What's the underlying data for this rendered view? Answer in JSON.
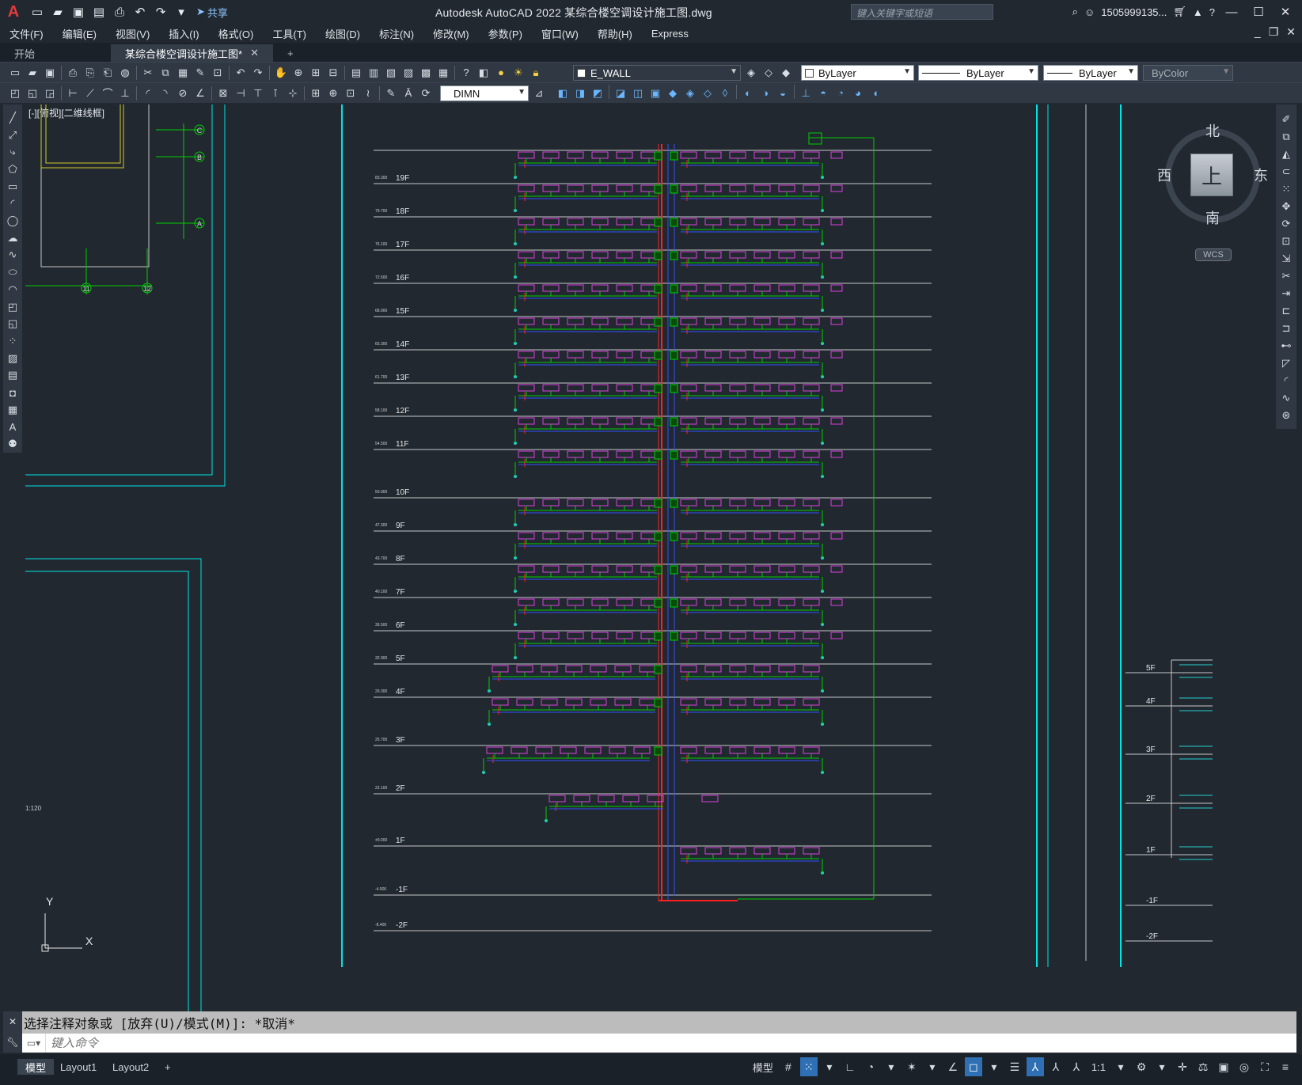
{
  "app": {
    "title": "Autodesk AutoCAD 2022    某综合楼空调设计施工图.dwg",
    "search_placeholder": "键入关键字或短语",
    "user": "1505999135...",
    "share_label": "共享"
  },
  "menu": [
    "文件(F)",
    "编辑(E)",
    "视图(V)",
    "插入(I)",
    "格式(O)",
    "工具(T)",
    "绘图(D)",
    "标注(N)",
    "修改(M)",
    "参数(P)",
    "窗口(W)",
    "帮助(H)",
    "Express"
  ],
  "tabs": [
    {
      "label": "开始"
    },
    {
      "label": "某综合楼空调设计施工图*"
    }
  ],
  "toolbar": {
    "layer": "E_WALL",
    "color": "ByLayer",
    "linetype": "ByLayer",
    "lineweight": "ByLayer",
    "plotstyle": "ByColor",
    "dimstyle": "DIMN"
  },
  "viewport": {
    "label": "[-][俯视][二维线框]",
    "viewcube": {
      "top": "上",
      "north": "北",
      "south": "南",
      "east": "东",
      "west": "西",
      "wcs": "WCS"
    }
  },
  "drawing": {
    "floors": [
      {
        "label": "19F",
        "elev": "83.300"
      },
      {
        "label": "18F",
        "elev": "79.700"
      },
      {
        "label": "17F",
        "elev": "76.100"
      },
      {
        "label": "16F",
        "elev": "72.500"
      },
      {
        "label": "15F",
        "elev": "68.900"
      },
      {
        "label": "14F",
        "elev": "65.300"
      },
      {
        "label": "13F",
        "elev": "61.700"
      },
      {
        "label": "12F",
        "elev": "58.100"
      },
      {
        "label": "11F",
        "elev": "54.500"
      },
      {
        "label": "10F",
        "elev": "50.900"
      },
      {
        "label": "9F",
        "elev": "47.300"
      },
      {
        "label": "8F",
        "elev": "43.700"
      },
      {
        "label": "7F",
        "elev": "40.100"
      },
      {
        "label": "6F",
        "elev": "36.500"
      },
      {
        "label": "5F",
        "elev": "32.900"
      },
      {
        "label": "4F",
        "elev": "29.300"
      },
      {
        "label": "3F",
        "elev": "25.700"
      },
      {
        "label": "2F",
        "elev": "22.100"
      },
      {
        "label": "1F",
        "elev": "±0.000"
      },
      {
        "label": "-1F",
        "elev": "-4.500"
      },
      {
        "label": "-2F",
        "elev": "-8.400"
      }
    ],
    "right_floors": [
      "5F",
      "4F",
      "3F",
      "2F",
      "1F",
      "-1F",
      "-2F"
    ],
    "axis_labels": [
      "C",
      "B",
      "A",
      "11",
      "12"
    ],
    "scale_note": "1:120",
    "ucs_x": "X",
    "ucs_y": "Y"
  },
  "command": {
    "history": "选择注释对象或 [放弃(U)/模式(M)]: *取消*",
    "placeholder": "键入命令"
  },
  "layout_tabs": [
    "模型",
    "Layout1",
    "Layout2"
  ],
  "status": {
    "model": "模型",
    "scale": "1:1"
  },
  "colors": {
    "background": "#212830",
    "cyan_frame": "#00e5e5",
    "pipe_green": "#00d000",
    "fan_coil_magenta": "#e040e0",
    "supply_red": "#ff2020",
    "return_blue": "#3050ff"
  }
}
